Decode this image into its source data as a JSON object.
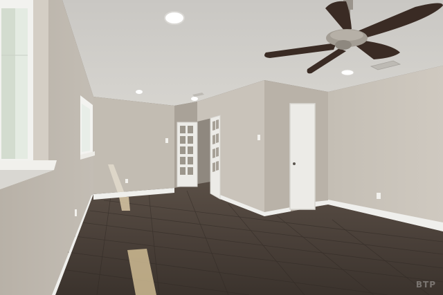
{
  "scene": {
    "description_tag": "empty-room-photo",
    "watermark": "BTP"
  },
  "colors": {
    "ceiling": "#cfcdc8",
    "wall_light": "#c7c1b8",
    "wall_shadow": "#aea79d",
    "floor_dark": "#3d352f",
    "floor_mid": "#574c43",
    "baseboard": "#efefec",
    "door_white": "#ecebe7",
    "fan_blade": "#3a2b24",
    "fan_metal": "#9a948c",
    "window_glass": "#e9efe9"
  }
}
